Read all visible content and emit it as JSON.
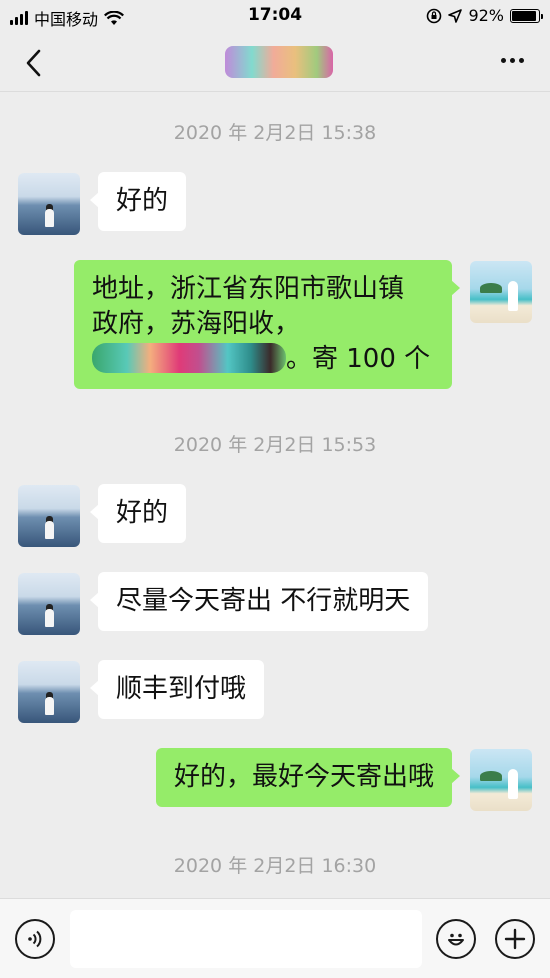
{
  "status_bar": {
    "carrier": "中国移动",
    "time": "17:04",
    "battery_percent": "92%",
    "battery_level": 0.92
  },
  "nav": {
    "back_icon": "chevron-left-icon",
    "more_icon": "ellipsis-icon"
  },
  "messages": [
    {
      "type": "timestamp",
      "text": "2020 年 2月2日 15:38"
    },
    {
      "type": "message",
      "side": "left",
      "text": "好的"
    },
    {
      "type": "message",
      "side": "right",
      "line1": "地址，浙江省东阳市歌山镇",
      "line2": "政府，苏海阳收，",
      "line3_suffix": "。寄 100 个"
    },
    {
      "type": "timestamp",
      "text": "2020 年 2月2日 15:53"
    },
    {
      "type": "message",
      "side": "left",
      "text": "好的"
    },
    {
      "type": "message",
      "side": "left",
      "text": "尽量今天寄出 不行就明天"
    },
    {
      "type": "message",
      "side": "left",
      "text": "顺丰到付哦"
    },
    {
      "type": "message",
      "side": "right",
      "text": "好的，最好今天寄出哦"
    },
    {
      "type": "timestamp",
      "text": "2020 年 2月2日 16:30"
    }
  ],
  "input_bar": {
    "voice_icon": "voice-icon",
    "emoji_icon": "emoji-icon",
    "plus_icon": "plus-icon",
    "value": ""
  },
  "colors": {
    "background": "#ededed",
    "bubble_sent": "#95ec69",
    "bubble_received": "#ffffff",
    "timestamp": "#a3a3a3"
  }
}
